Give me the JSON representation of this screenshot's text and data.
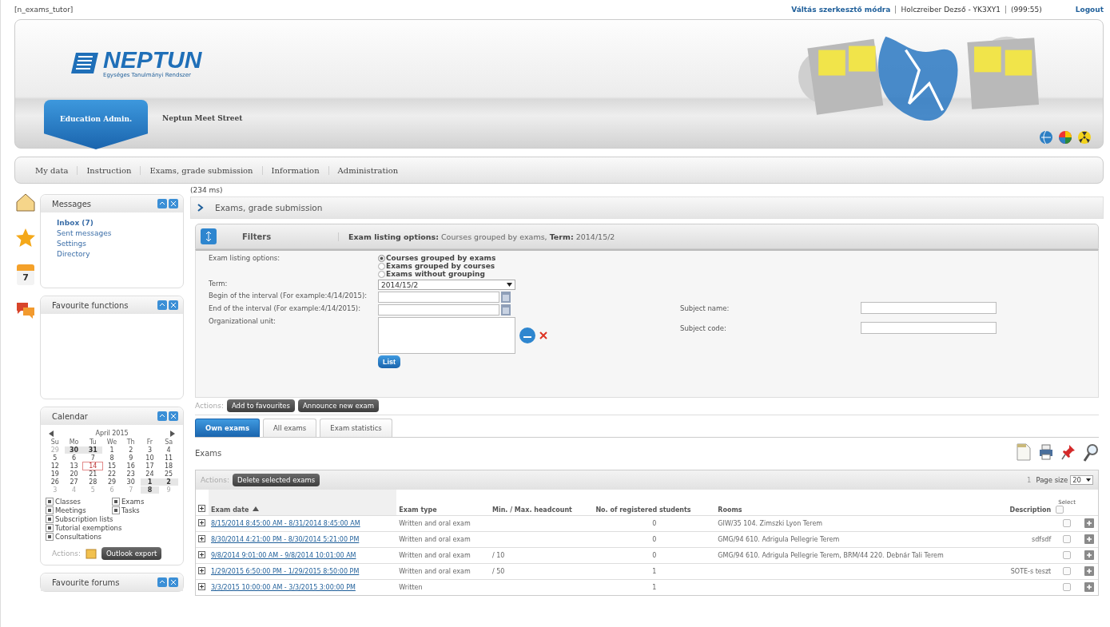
{
  "top_bar": {
    "role": "[n_exams_tutor]",
    "links": [
      {
        "label": "Váltás szerkesztő módra",
        "kind": "link"
      },
      {
        "label": "Holczreiber Dezső - YK3XY1",
        "kind": "text"
      },
      {
        "label": "(999:55)",
        "kind": "text"
      }
    ],
    "logout": "Logout"
  },
  "header": {
    "logo": "NEPTUN",
    "logo_subtitle": "Egységes Tanulmányi Rendszer",
    "tabs": [
      {
        "label": "Education Admin.",
        "selected": true
      },
      {
        "label": "Neptun Meet Street",
        "selected": false
      }
    ]
  },
  "menu": [
    "My data",
    "Instruction",
    "Exams, grade submission",
    "Information",
    "Administration"
  ],
  "shortcuts": {
    "calendar_day": "7"
  },
  "sidebar": {
    "messages": {
      "title": "Messages",
      "items": [
        {
          "label": "Inbox (7)",
          "bold": true
        },
        {
          "label": "Sent messages",
          "bold": false
        },
        {
          "label": "Settings",
          "bold": false
        },
        {
          "label": "Directory",
          "bold": false
        }
      ]
    },
    "favourites": {
      "title": "Favourite functions"
    },
    "calendar": {
      "title": "Calendar",
      "month": "April 2015",
      "weekdays": [
        "Su",
        "Mo",
        "Tu",
        "We",
        "Th",
        "Fr",
        "Sa"
      ],
      "weeks": [
        [
          {
            "day": "29",
            "other_month": true,
            "marked": false,
            "today": false
          },
          {
            "day": "30",
            "other_month": true,
            "marked": true,
            "today": false
          },
          {
            "day": "31",
            "other_month": true,
            "marked": true,
            "today": false
          },
          {
            "day": "1",
            "other_month": false,
            "marked": false,
            "today": false
          },
          {
            "day": "2",
            "other_month": false,
            "marked": false,
            "today": false
          },
          {
            "day": "3",
            "other_month": false,
            "marked": false,
            "today": false
          },
          {
            "day": "4",
            "other_month": false,
            "marked": false,
            "today": false
          }
        ],
        [
          {
            "day": "5",
            "other_month": false,
            "marked": false,
            "today": false
          },
          {
            "day": "6",
            "other_month": false,
            "marked": false,
            "today": false
          },
          {
            "day": "7",
            "other_month": false,
            "marked": false,
            "today": false
          },
          {
            "day": "8",
            "other_month": false,
            "marked": false,
            "today": false
          },
          {
            "day": "9",
            "other_month": false,
            "marked": false,
            "today": false
          },
          {
            "day": "10",
            "other_month": false,
            "marked": false,
            "today": false
          },
          {
            "day": "11",
            "other_month": false,
            "marked": false,
            "today": false
          }
        ],
        [
          {
            "day": "12",
            "other_month": false,
            "marked": false,
            "today": false
          },
          {
            "day": "13",
            "other_month": false,
            "marked": false,
            "today": false
          },
          {
            "day": "14",
            "other_month": false,
            "marked": false,
            "today": true
          },
          {
            "day": "15",
            "other_month": false,
            "marked": false,
            "today": false
          },
          {
            "day": "16",
            "other_month": false,
            "marked": false,
            "today": false
          },
          {
            "day": "17",
            "other_month": false,
            "marked": false,
            "today": false
          },
          {
            "day": "18",
            "other_month": false,
            "marked": false,
            "today": false
          }
        ],
        [
          {
            "day": "19",
            "other_month": false,
            "marked": false,
            "today": false
          },
          {
            "day": "20",
            "other_month": false,
            "marked": false,
            "today": false
          },
          {
            "day": "21",
            "other_month": false,
            "marked": false,
            "today": false
          },
          {
            "day": "22",
            "other_month": false,
            "marked": false,
            "today": false
          },
          {
            "day": "23",
            "other_month": false,
            "marked": false,
            "today": false
          },
          {
            "day": "24",
            "other_month": false,
            "marked": false,
            "today": false
          },
          {
            "day": "25",
            "other_month": false,
            "marked": false,
            "today": false
          }
        ],
        [
          {
            "day": "26",
            "other_month": false,
            "marked": false,
            "today": false
          },
          {
            "day": "27",
            "other_month": false,
            "marked": false,
            "today": false
          },
          {
            "day": "28",
            "other_month": false,
            "marked": false,
            "today": false
          },
          {
            "day": "29",
            "other_month": false,
            "marked": false,
            "today": false
          },
          {
            "day": "30",
            "other_month": false,
            "marked": false,
            "today": false
          },
          {
            "day": "1",
            "other_month": true,
            "marked": true,
            "today": false
          },
          {
            "day": "2",
            "other_month": true,
            "marked": true,
            "today": false
          }
        ],
        [
          {
            "day": "3",
            "other_month": true,
            "marked": false,
            "today": false
          },
          {
            "day": "4",
            "other_month": true,
            "marked": false,
            "today": false
          },
          {
            "day": "5",
            "other_month": true,
            "marked": false,
            "today": false
          },
          {
            "day": "6",
            "other_month": true,
            "marked": false,
            "today": false
          },
          {
            "day": "7",
            "other_month": true,
            "marked": false,
            "today": false
          },
          {
            "day": "8",
            "other_month": true,
            "marked": true,
            "today": false
          },
          {
            "day": "9",
            "other_month": true,
            "marked": false,
            "today": false
          }
        ]
      ],
      "filters": [
        {
          "label": "Classes",
          "checked": true
        },
        {
          "label": "Exams",
          "checked": true
        },
        {
          "label": "Meetings",
          "checked": true
        },
        {
          "label": "Tasks",
          "checked": true
        },
        {
          "label": "Subscription lists",
          "checked": true
        },
        {
          "label": "Tutorial exemptions",
          "checked": true
        },
        {
          "label": "Consultations",
          "checked": true
        }
      ],
      "actions_label": "Actions:",
      "export_button": "Outlook export"
    },
    "forums": {
      "title": "Favourite forums"
    }
  },
  "timing": "(234 ms)",
  "section_title": "Exams, grade submission",
  "filters": {
    "title": "Filters",
    "summary": "**Exam listing options:** Courses grouped by exams, **Term:** 2014/15/2",
    "listing_label": "Exam listing options:",
    "listing_options": [
      {
        "label": "Courses grouped by exams",
        "selected": true
      },
      {
        "label": "Exams grouped by courses",
        "selected": false
      },
      {
        "label": "Exams without grouping",
        "selected": false
      }
    ],
    "term_label": "Term:",
    "term_value": "2014/15/2",
    "begin_label": "Begin of the interval (For example:4/14/2015):",
    "end_label": "End of the interval (For example:4/14/2015):",
    "org_label": "Organizational unit:",
    "subject_name_label": "Subject name:",
    "subject_code_label": "Subject code:",
    "list_button": "List"
  },
  "actions": {
    "label": "Actions:",
    "buttons": [
      "Add to favourites",
      "Announce new exam"
    ]
  },
  "tabs": [
    {
      "label": "Own exams",
      "selected": true
    },
    {
      "label": "All exams",
      "selected": false
    },
    {
      "label": "Exam statistics",
      "selected": false
    }
  ],
  "exams": {
    "title": "Exams",
    "actions_label": "Actions:",
    "delete_button": "Delete selected exams",
    "page": "1",
    "page_size_label": "Page size",
    "page_size": "20",
    "select_all": false,
    "columns": [
      "Exam date",
      "Exam type",
      "Min. / Max. headcount",
      "No. of registered students",
      "Rooms",
      "Description",
      "Select"
    ],
    "rows": [
      {
        "date": "8/15/2014 8:45:00 AM - 8/31/2014 8:45:00 AM",
        "type": "Written and oral exam",
        "headcount": "",
        "students": "0",
        "rooms": "GIW/35 104. Zimszki Lyon Terem",
        "description": "",
        "selected": false
      },
      {
        "date": "8/30/2014 4:21:00 PM - 8/30/2014 5:21:00 PM",
        "type": "Written and oral exam",
        "headcount": "",
        "students": "0",
        "rooms": "GMG/94 610. Adrigula Pellegrie Terem",
        "description": "sdfsdf",
        "selected": false
      },
      {
        "date": "9/8/2014 9:01:00 AM - 9/8/2014 10:01:00 AM",
        "type": "Written and oral exam",
        "headcount": "/ 10",
        "students": "0",
        "rooms": "GMG/94 610. Adrigula Pellegrie Terem, BRM/44 220. Debnár Tali Terem",
        "description": "",
        "selected": false
      },
      {
        "date": "1/29/2015 6:50:00 PM - 1/29/2015 8:50:00 PM",
        "type": "Written and oral exam",
        "headcount": "/ 50",
        "students": "1",
        "rooms": "",
        "description": "SOTE-s teszt",
        "selected": false
      },
      {
        "date": "3/3/2015 10:00:00 AM - 3/3/2015 3:00:00 PM",
        "type": "Written",
        "headcount": "",
        "students": "1",
        "rooms": "",
        "description": "",
        "selected": false
      }
    ]
  }
}
